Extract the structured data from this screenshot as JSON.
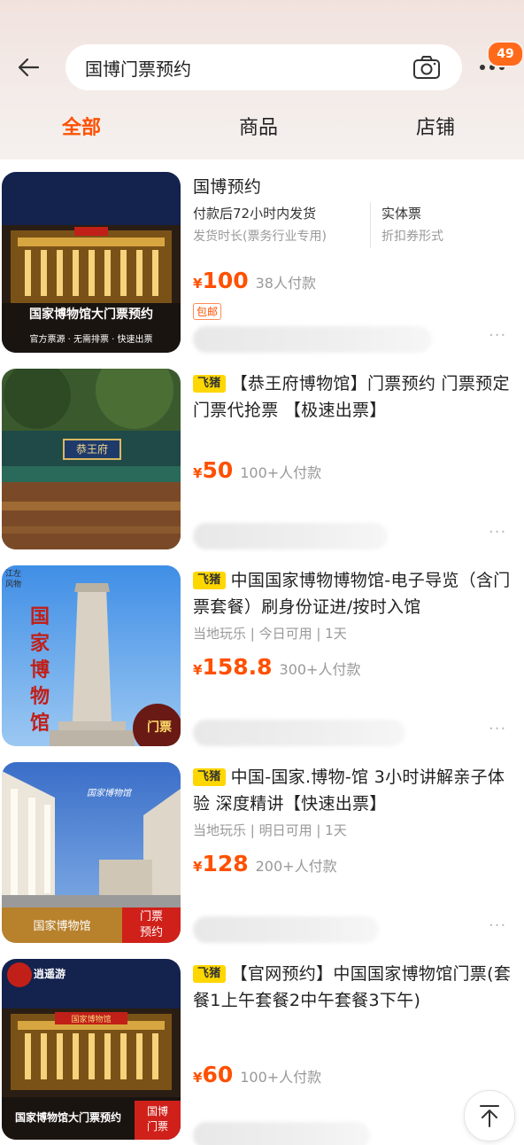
{
  "search": {
    "query": "国博门票预约"
  },
  "header": {
    "badge": "49"
  },
  "tabs": [
    {
      "label": "全部",
      "active": true
    },
    {
      "label": "商品",
      "active": false
    },
    {
      "label": "店铺",
      "active": false
    }
  ],
  "products": [
    {
      "title": "国博预约",
      "attr_left_1": "付款后72小时内发货",
      "attr_left_2": "发货时长(票务行业专用)",
      "attr_right_1": "实体票",
      "attr_right_2": "折扣券形式",
      "price": "100",
      "buyers": "38人付款",
      "tag": "包邮",
      "thumb_caption": "国家博物馆大门票预约",
      "thumb_sub": "官方票源 · 无需排票 · 快速出票"
    },
    {
      "brand_tag": "飞猪",
      "title": "【恭王府博物馆】门票预约 门票预定 门票代抢票 【极速出票】",
      "price": "50",
      "buyers": "100+人付款",
      "thumb_sign": "恭王府"
    },
    {
      "brand_tag": "飞猪",
      "title": "中国国家博物博物馆-电子导览（含门票套餐）刷身份证进/按时入馆",
      "attrs": "当地玩乐 | 今日可用 | 1天",
      "price": "158.8",
      "buyers": "300+人付款",
      "thumb_vertical": "国家博物馆",
      "thumb_logo": "江左\n风物",
      "thumb_corner": "门票"
    },
    {
      "brand_tag": "飞猪",
      "title": "中国-国家.博物-馆 3小时讲解亲子体验 深度精讲【快速出票】",
      "attrs": "当地玩乐 | 明日可用 | 1天",
      "price": "128",
      "buyers": "200+人付款",
      "thumb_caption": "国家博物馆",
      "thumb_corner": "门票\n预约",
      "thumb_sky": "国家博物馆"
    },
    {
      "brand_tag": "飞猪",
      "title": "【官网预约】中国国家博物馆门票(套餐1上午套餐2中午套餐3下午)",
      "price": "60",
      "buyers": "100+人付款",
      "thumb_caption": "国家博物馆大门票预约",
      "thumb_corner": "国博\n门票",
      "thumb_logo": "逍遥游",
      "thumb_sign": "国家博物馆"
    }
  ],
  "symbols": {
    "yen": "¥",
    "more_dots": "···"
  },
  "colors": {
    "accent": "#ff5000",
    "badge": "#ff6a1a",
    "feizhu_tag": "#ffd700"
  },
  "icons": [
    "back-arrow-icon",
    "camera-icon",
    "more-dots-icon",
    "back-to-top-icon"
  ]
}
